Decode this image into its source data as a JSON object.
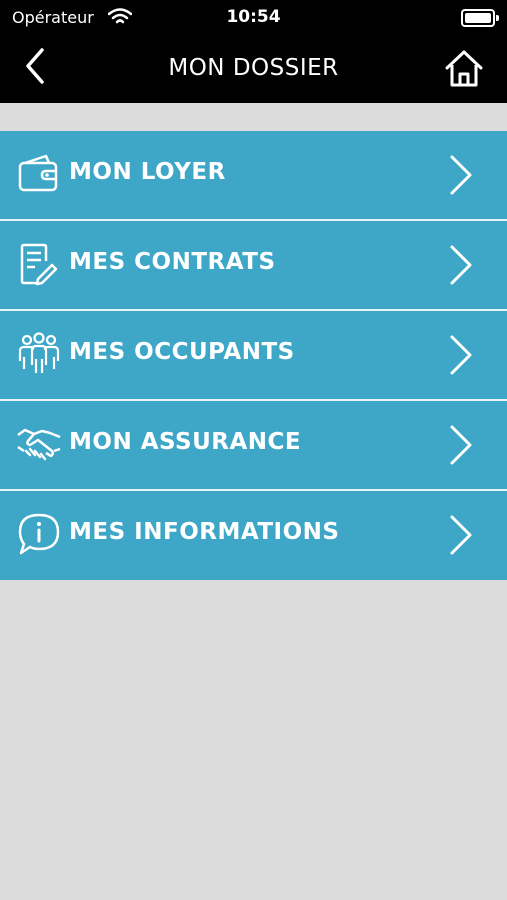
{
  "status_bar": {
    "carrier": "Opérateur",
    "time": "10:54"
  },
  "header": {
    "title": "MON DOSSIER"
  },
  "menu": {
    "items": [
      {
        "label": "MON LOYER",
        "icon": "wallet-icon"
      },
      {
        "label": "MES CONTRATS",
        "icon": "contract-icon"
      },
      {
        "label": "MES OCCUPANTS",
        "icon": "people-icon"
      },
      {
        "label": "MON ASSURANCE",
        "icon": "handshake-icon"
      },
      {
        "label": "MES INFORMATIONS",
        "icon": "info-bubble-icon"
      }
    ]
  },
  "colors": {
    "accent": "#3ea7c7",
    "header_bg": "#000000",
    "page_bg": "#dcdcdc"
  }
}
